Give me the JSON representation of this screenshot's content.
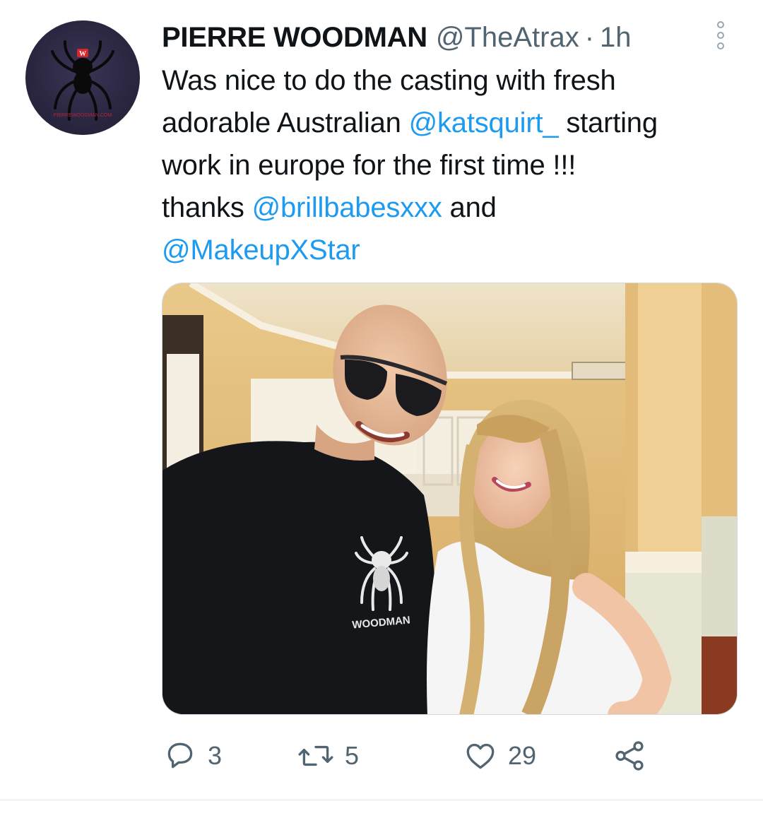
{
  "tweet": {
    "author_name": "PIERRE WOODMAN",
    "handle": "@TheAtrax",
    "separator": "·",
    "time": "1h",
    "text_lines": [
      [
        {
          "t": "Was nice to do the casting with fresh",
          "m": false
        }
      ],
      [
        {
          "t": "adorable Australian ",
          "m": false
        },
        {
          "t": "@katsquirt_",
          "m": true
        },
        {
          "t": " starting",
          "m": false
        }
      ],
      [
        {
          "t": "work in europe for the first time !!!",
          "m": false
        }
      ],
      [
        {
          "t": "thanks ",
          "m": false
        },
        {
          "t": "@brillbabesxxx",
          "m": true
        },
        {
          "t": " and",
          "m": false
        }
      ],
      [
        {
          "t": "@MakeupXStar",
          "m": true
        }
      ]
    ],
    "photo_shirt_text": "WOODMAN",
    "avatar_logo_letter": "W",
    "avatar_text": "PIERREWOODMAN.COM"
  },
  "actions": {
    "replies": "3",
    "retweets": "5",
    "likes": "29"
  },
  "icons": {
    "reply": "reply-icon",
    "retweet": "retweet-icon",
    "like": "heart-icon",
    "share": "share-icon",
    "more": "more-options-icon"
  },
  "colors": {
    "text": "#0f1419",
    "secondary": "#536471",
    "link": "#1d9bf0",
    "divider": "#e1e8ed"
  }
}
